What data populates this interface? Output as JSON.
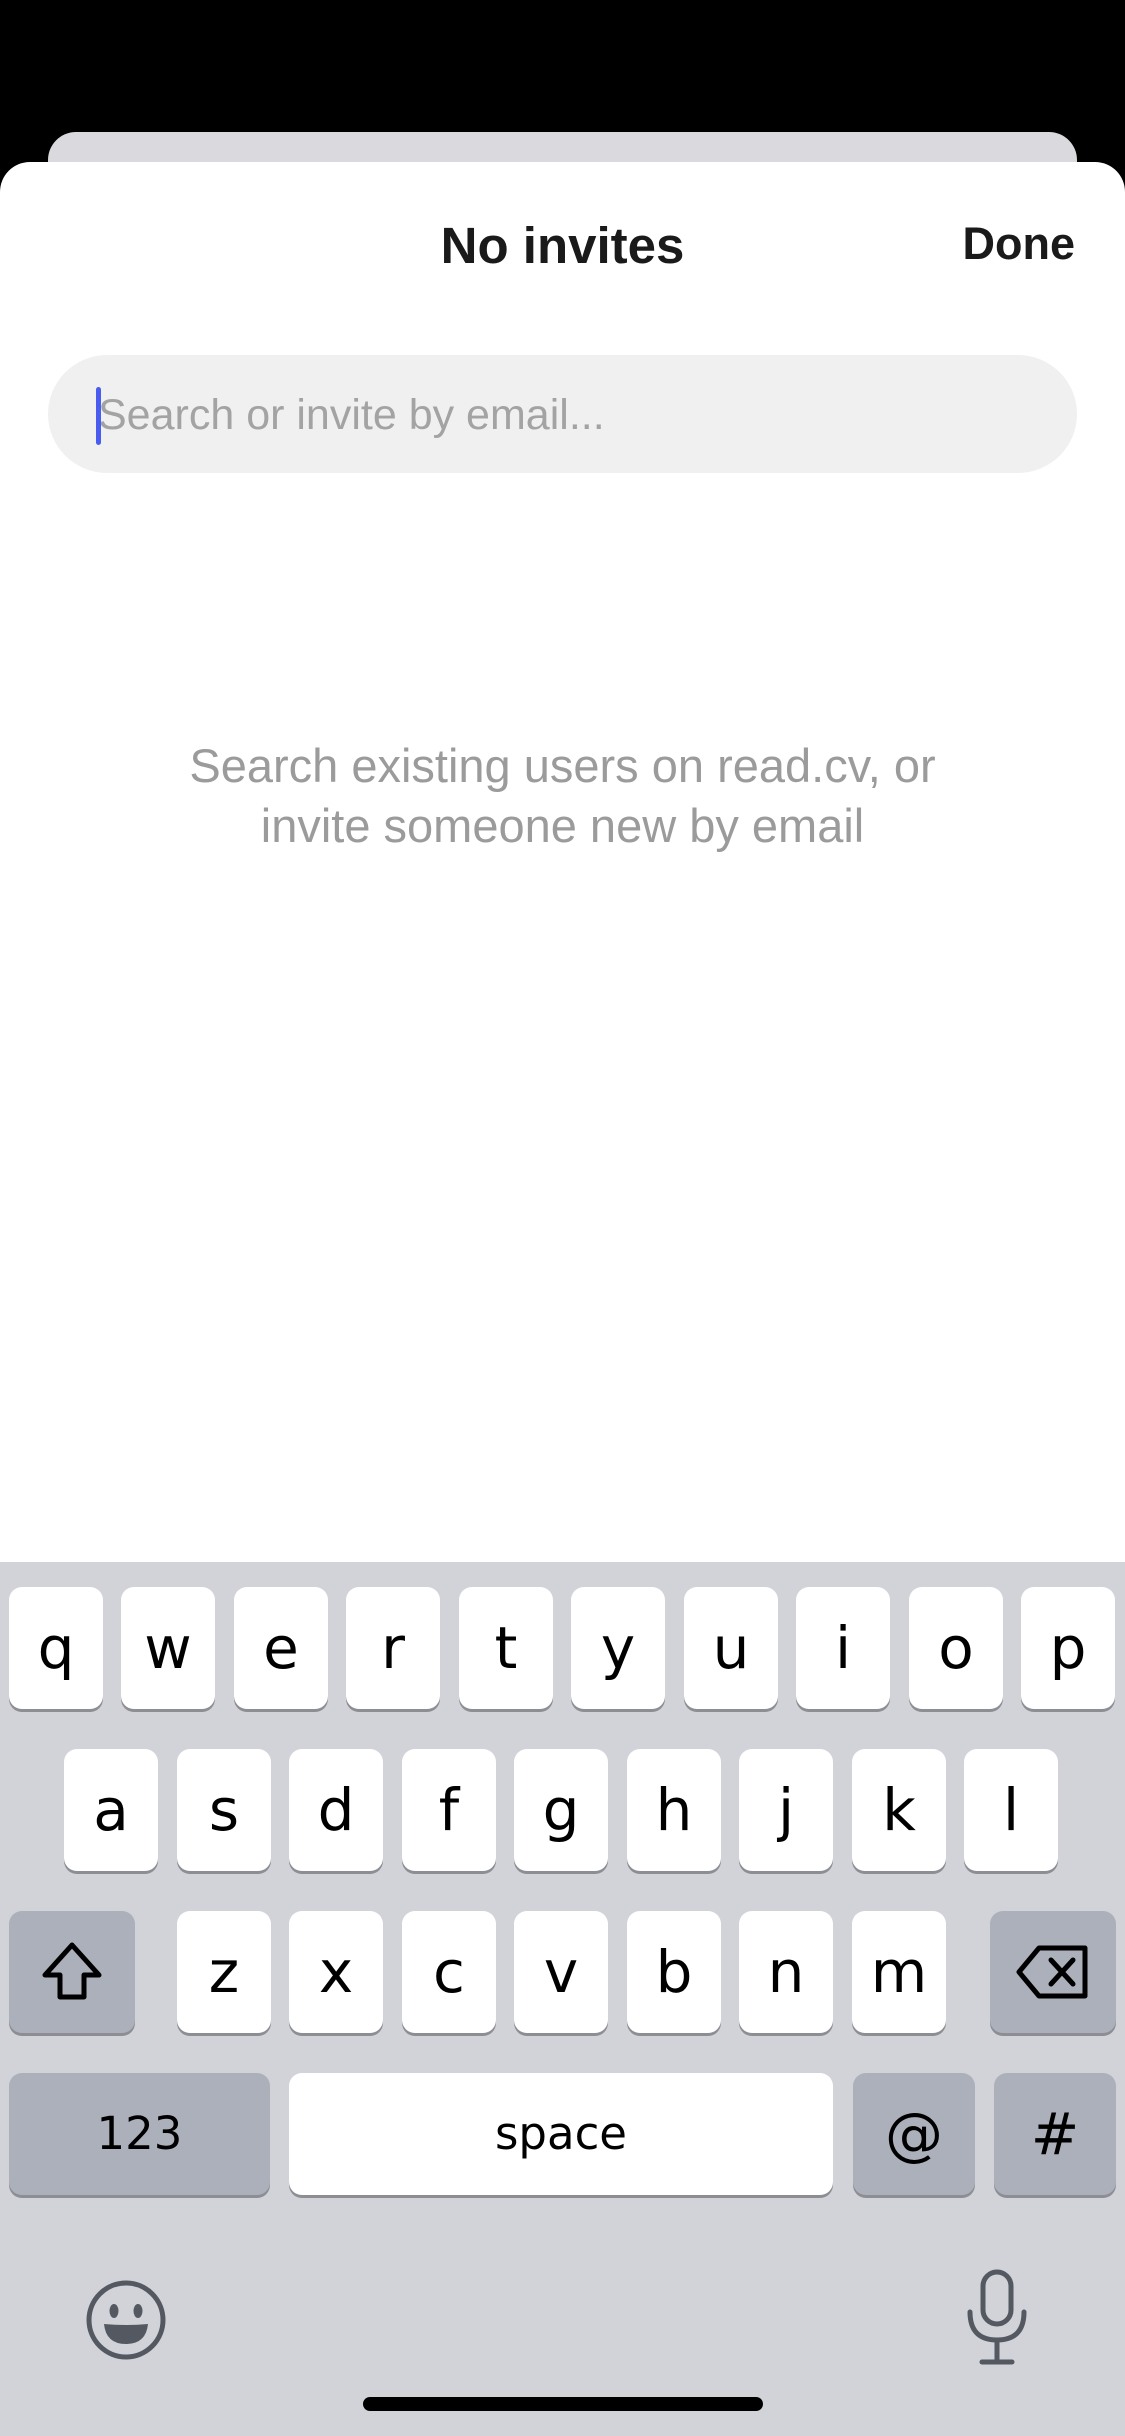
{
  "sheet": {
    "title": "No invites",
    "done_label": "Done"
  },
  "search": {
    "placeholder": "Search or invite by email..."
  },
  "hint": {
    "line1": "Search existing users on read.cv, or",
    "line2": "invite someone new by email"
  },
  "keyboard": {
    "row1": [
      "q",
      "w",
      "e",
      "r",
      "t",
      "y",
      "u",
      "i",
      "o",
      "p"
    ],
    "row2": [
      "a",
      "s",
      "d",
      "f",
      "g",
      "h",
      "j",
      "k",
      "l"
    ],
    "row3": [
      "z",
      "x",
      "c",
      "v",
      "b",
      "n",
      "m"
    ],
    "numbers_label": "123",
    "space_label": "space",
    "at_label": "@",
    "hash_label": "#",
    "shift_icon": "shift-icon",
    "delete_icon": "backspace-icon",
    "emoji_icon": "emoji-icon",
    "mic_icon": "microphone-icon"
  }
}
